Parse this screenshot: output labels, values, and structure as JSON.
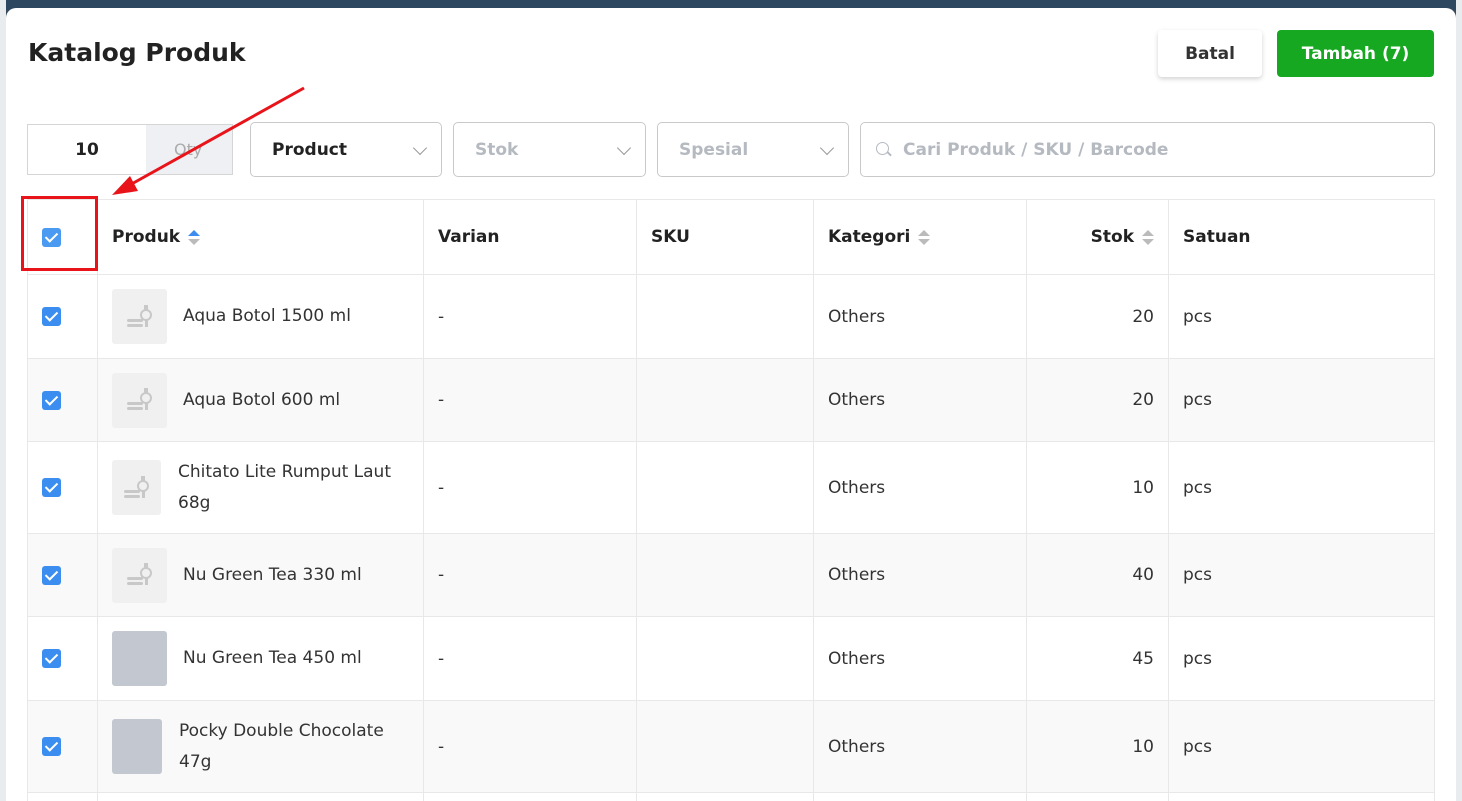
{
  "modal": {
    "title": "Katalog Produk",
    "cancel_label": "Batal",
    "add_label": "Tambah (7)"
  },
  "filters": {
    "qty_value": "10",
    "qty_unit": "Qty",
    "product_select": "Product",
    "stok_select": "Stok",
    "spesial_select": "Spesial",
    "search_placeholder": "Cari Produk / SKU / Barcode"
  },
  "table": {
    "headers": {
      "produk": "Produk",
      "varian": "Varian",
      "sku": "SKU",
      "kategori": "Kategori",
      "stok": "Stok",
      "satuan": "Satuan"
    },
    "rows": [
      {
        "name": "Aqua Botol 1500 ml",
        "varian": "-",
        "sku": "",
        "kategori": "Others",
        "stok": "20",
        "satuan": "pcs"
      },
      {
        "name": "Aqua Botol 600 ml",
        "varian": "-",
        "sku": "",
        "kategori": "Others",
        "stok": "20",
        "satuan": "pcs"
      },
      {
        "name": "Chitato Lite Rumput Laut 68g",
        "varian": "-",
        "sku": "",
        "kategori": "Others",
        "stok": "10",
        "satuan": "pcs"
      },
      {
        "name": "Nu Green Tea 330 ml",
        "varian": "-",
        "sku": "",
        "kategori": "Others",
        "stok": "40",
        "satuan": "pcs"
      },
      {
        "name": "Nu Green Tea 450 ml",
        "varian": "-",
        "sku": "",
        "kategori": "Others",
        "stok": "45",
        "satuan": "pcs"
      },
      {
        "name": "Pocky Double Chocolate 47g",
        "varian": "-",
        "sku": "",
        "kategori": "Others",
        "stok": "10",
        "satuan": "pcs"
      }
    ]
  },
  "colors": {
    "primary_green": "#15a820",
    "checkbox_blue": "#3b8ef0",
    "annotation_red": "#e8141a"
  }
}
